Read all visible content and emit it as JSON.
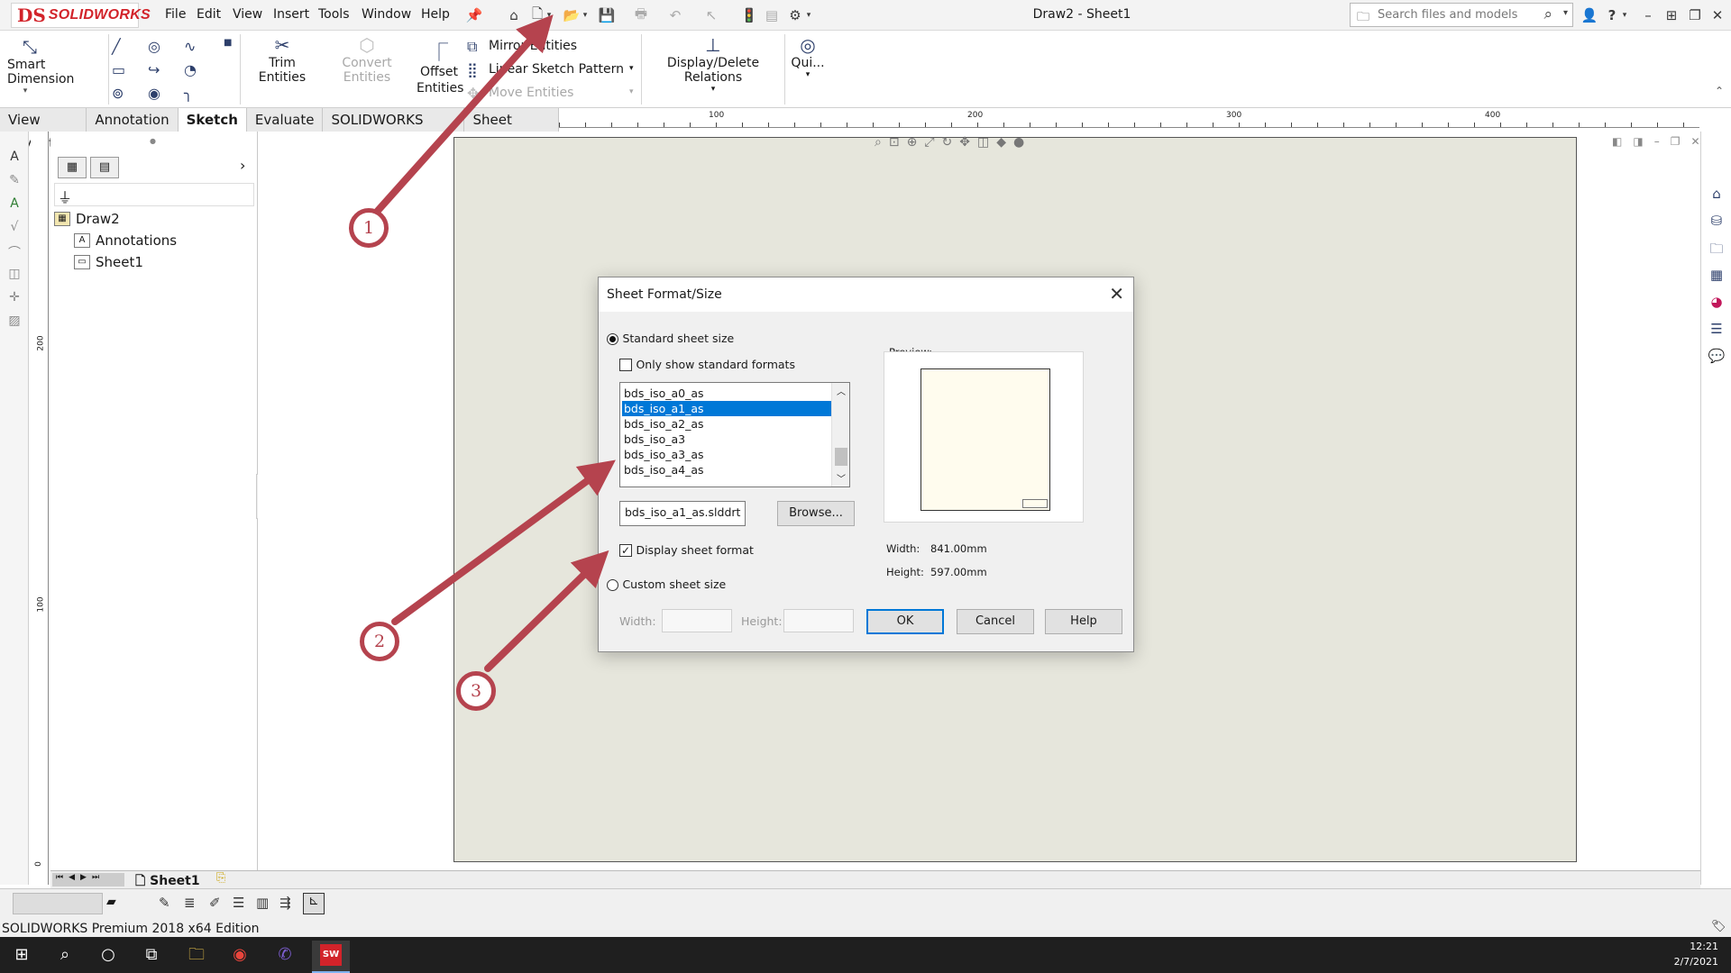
{
  "app": {
    "logo_mark": "DS",
    "logo_text": "SOLIDWORKS",
    "document_title": "Draw2 - Sheet1",
    "menu": [
      "File",
      "Edit",
      "View",
      "Insert",
      "Tools",
      "Window",
      "Help"
    ],
    "search_placeholder": "Search files and models",
    "help_label": "?"
  },
  "ribbon": {
    "smart_dimension": "Smart Dimension",
    "trim_entities": "Trim Entities",
    "convert_entities": "Convert Entities",
    "offset_entities_line1": "Offset",
    "offset_entities_line2": "Entities",
    "mirror_entities": "Mirror Entities",
    "linear_pattern": "Linear Sketch Pattern",
    "move_entities": "Move Entities",
    "display_delete_relations": "Display/Delete Relations",
    "quick_snaps": "Qui..."
  },
  "tabs": [
    {
      "label": "View Layout",
      "active": false
    },
    {
      "label": "Annotation",
      "active": false
    },
    {
      "label": "Sketch",
      "active": true
    },
    {
      "label": "Evaluate",
      "active": false
    },
    {
      "label": "SOLIDWORKS Add-Ins",
      "active": false
    },
    {
      "label": "Sheet Format",
      "active": false
    }
  ],
  "ruler": {
    "h_labels": [
      "100",
      "200",
      "300",
      "400"
    ],
    "v_labels": [
      "200",
      "100",
      "0"
    ]
  },
  "tree": {
    "root": "Draw2",
    "items": [
      "Annotations",
      "Sheet1"
    ]
  },
  "dialog": {
    "title": "Sheet Format/Size",
    "standard_size_label": "Standard sheet size",
    "only_standard_label": "Only show standard formats",
    "formats": [
      "bds_iso_a0_as",
      "bds_iso_a1_as",
      "bds_iso_a2_as",
      "bds_iso_a3",
      "bds_iso_a3_as",
      "bds_iso_a4_as"
    ],
    "selected_format": "bds_iso_a1_as",
    "file_value": "bds_iso_a1_as.slddrt",
    "browse_label": "Browse...",
    "display_format_label": "Display sheet format",
    "display_format_checked": true,
    "custom_size_label": "Custom sheet size",
    "width_label": "Width:",
    "height_label": "Height:",
    "preview_label": "Preview:",
    "preview_width_label": "Width:",
    "preview_width_value": "841.00mm",
    "preview_height_label": "Height:",
    "preview_height_value": "597.00mm",
    "ok_label": "OK",
    "cancel_label": "Cancel",
    "help_label": "Help"
  },
  "callouts": [
    "1",
    "2",
    "3"
  ],
  "bottom": {
    "sheet_tab": "Sheet1",
    "status_text": "SOLIDWORKS Premium 2018 x64 Edition"
  },
  "taskbar": {
    "time": "12:21",
    "date": "2/7/2021",
    "sw_label": "SW"
  },
  "colors": {
    "accent": "#0078d7",
    "callout": "#b5434e",
    "brand": "#d2232a",
    "sheet_bg": "#e6e6dc"
  }
}
